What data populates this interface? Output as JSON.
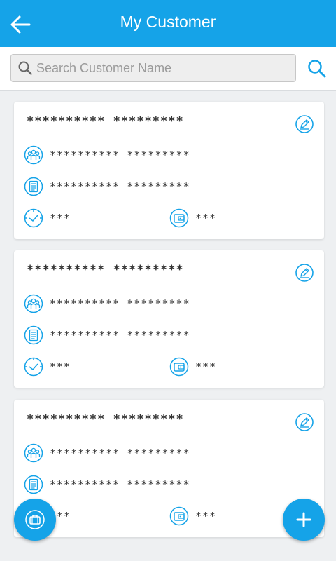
{
  "header": {
    "title": "My Customer"
  },
  "search": {
    "placeholder": "Search Customer Name",
    "value": ""
  },
  "customers": [
    {
      "name": "********** *********",
      "group": "********** *********",
      "document": "********** *********",
      "time": "***",
      "wallet": "***"
    },
    {
      "name": "********** *********",
      "group": "********** *********",
      "document": "********** *********",
      "time": "***",
      "wallet": "***"
    },
    {
      "name": "********** *********",
      "group": "********** *********",
      "document": "********** *********",
      "time": "***",
      "wallet": "***"
    }
  ],
  "colors": {
    "accent": "#15a3e8",
    "background": "#eef0f2",
    "card": "#ffffff",
    "text": "#333333"
  },
  "icons": [
    "back-arrow-icon",
    "search-icon",
    "edit-icon",
    "group-icon",
    "document-icon",
    "clock-icon",
    "wallet-icon",
    "briefcase-icon",
    "plus-icon"
  ]
}
